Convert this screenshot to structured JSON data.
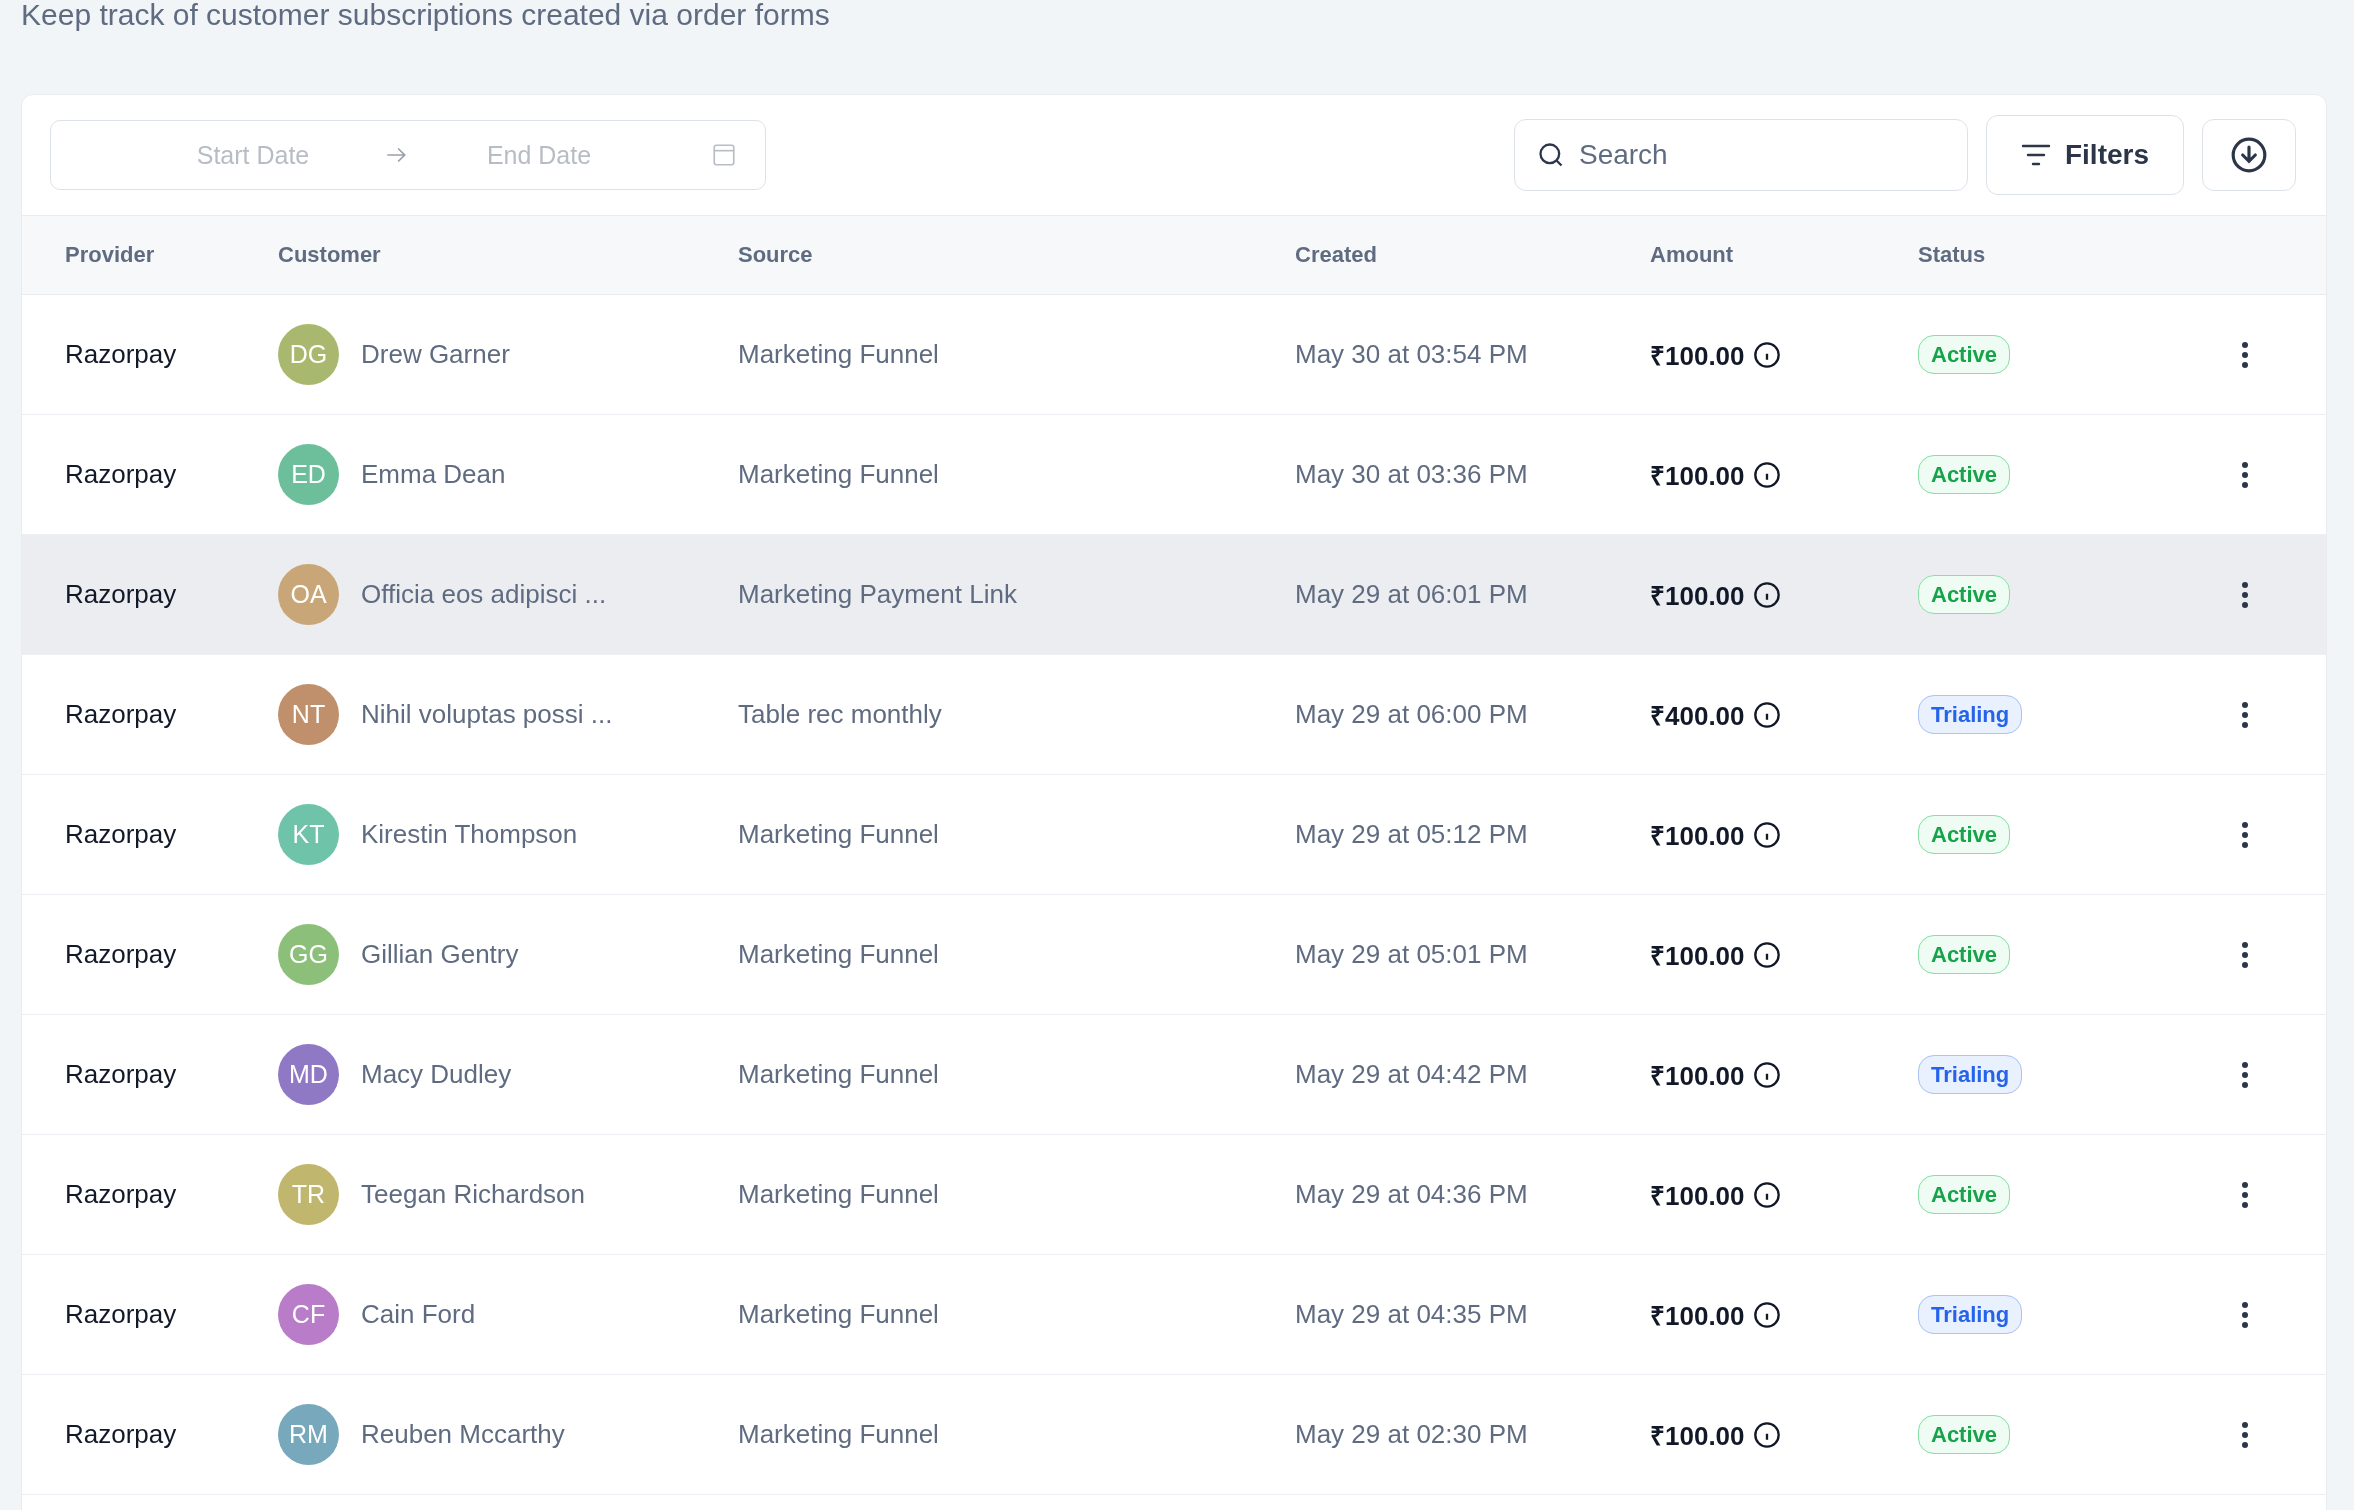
{
  "subtitle": "Keep track of customer subscriptions created via order forms",
  "toolbar": {
    "start_date": {
      "placeholder": "Start Date"
    },
    "end_date": {
      "placeholder": "End Date"
    },
    "search": {
      "placeholder": "Search"
    },
    "filters_button": "Filters"
  },
  "table": {
    "columns": [
      "Provider",
      "Customer",
      "Source",
      "Created",
      "Amount",
      "Status"
    ],
    "rows": [
      {
        "provider": "Razorpay",
        "initials": "DG",
        "color": "#a8b96f",
        "customer": "Drew Garner",
        "source": "Marketing Funnel",
        "created": "May 30 at 03:54 PM",
        "amount": "₹100.00",
        "status": {
          "kind": "active",
          "label": "Active"
        },
        "highlighted": false
      },
      {
        "provider": "Razorpay",
        "initials": "ED",
        "color": "#6dbf9b",
        "customer": "Emma Dean",
        "source": "Marketing Funnel",
        "created": "May 30 at 03:36 PM",
        "amount": "₹100.00",
        "status": {
          "kind": "active",
          "label": "Active"
        },
        "highlighted": false
      },
      {
        "provider": "Razorpay",
        "initials": "OA",
        "color": "#c9a678",
        "customer": "Officia eos adipisci ...",
        "source": "Marketing Payment Link",
        "created": "May 29 at 06:01 PM",
        "amount": "₹100.00",
        "status": {
          "kind": "active",
          "label": "Active"
        },
        "highlighted": true
      },
      {
        "provider": "Razorpay",
        "initials": "NT",
        "color": "#c0906c",
        "customer": "Nihil voluptas possi ...",
        "source": "Table rec monthly",
        "created": "May 29 at 06:00 PM",
        "amount": "₹400.00",
        "status": {
          "kind": "trialing",
          "label": "Trialing"
        },
        "highlighted": false
      },
      {
        "provider": "Razorpay",
        "initials": "KT",
        "color": "#6fc3a8",
        "customer": "Kirestin Thompson",
        "source": "Marketing Funnel",
        "created": "May 29 at 05:12 PM",
        "amount": "₹100.00",
        "status": {
          "kind": "active",
          "label": "Active"
        },
        "highlighted": false
      },
      {
        "provider": "Razorpay",
        "initials": "GG",
        "color": "#8cc07a",
        "customer": "Gillian Gentry",
        "source": "Marketing Funnel",
        "created": "May 29 at 05:01 PM",
        "amount": "₹100.00",
        "status": {
          "kind": "active",
          "label": "Active"
        },
        "highlighted": false
      },
      {
        "provider": "Razorpay",
        "initials": "MD",
        "color": "#9079c4",
        "customer": "Macy Dudley",
        "source": "Marketing Funnel",
        "created": "May 29 at 04:42 PM",
        "amount": "₹100.00",
        "status": {
          "kind": "trialing",
          "label": "Trialing"
        },
        "highlighted": false
      },
      {
        "provider": "Razorpay",
        "initials": "TR",
        "color": "#c0b66e",
        "customer": "Teegan Richardson",
        "source": "Marketing Funnel",
        "created": "May 29 at 04:36 PM",
        "amount": "₹100.00",
        "status": {
          "kind": "active",
          "label": "Active"
        },
        "highlighted": false
      },
      {
        "provider": "Razorpay",
        "initials": "CF",
        "color": "#b97cc8",
        "customer": "Cain Ford",
        "source": "Marketing Funnel",
        "created": "May 29 at 04:35 PM",
        "amount": "₹100.00",
        "status": {
          "kind": "trialing",
          "label": "Trialing"
        },
        "highlighted": false
      },
      {
        "provider": "Razorpay",
        "initials": "RM",
        "color": "#78a8bb",
        "customer": "Reuben Mccarthy",
        "source": "Marketing Funnel",
        "created": "May 29 at 02:30 PM",
        "amount": "₹100.00",
        "status": {
          "kind": "active",
          "label": "Active"
        },
        "highlighted": false
      }
    ]
  }
}
